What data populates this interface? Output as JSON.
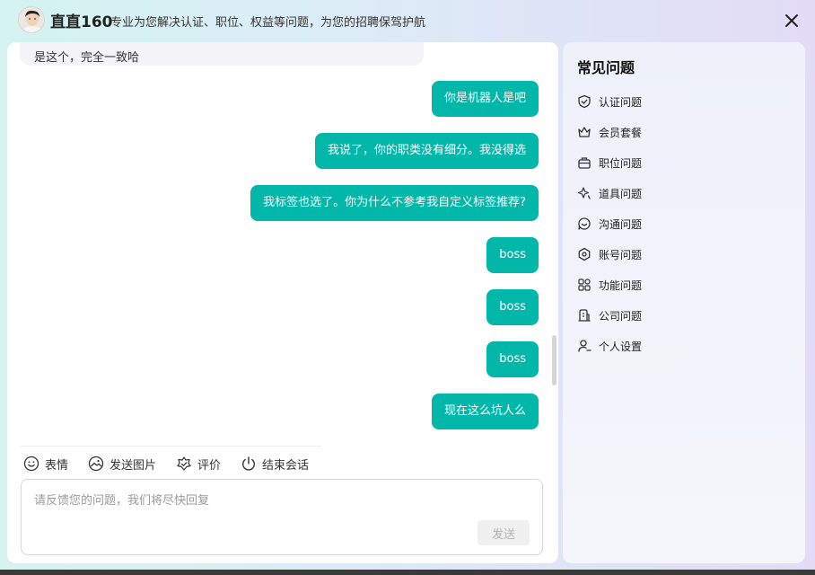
{
  "header": {
    "brand": "直直160",
    "slogan": "专业为您解决认证、职位、权益等问题，为您的招聘保驾护航"
  },
  "chat": {
    "previous_text": "是这个，完全一致哈",
    "messages": [
      "你是机器人是吧",
      "我说了，你的职类没有细分。我没得选",
      "我标签也选了。你为什么不参考我自定义标签推荐?",
      "boss",
      "boss",
      "boss",
      "现在这么坑人么"
    ]
  },
  "toolbar": {
    "emoji": "表情",
    "image": "发送图片",
    "rate": "评价",
    "end": "结束会话"
  },
  "input": {
    "placeholder": "请反馈您的问题，我们将尽快回复",
    "send": "发送"
  },
  "faq": {
    "title": "常见问题",
    "items": [
      {
        "label": "认证问题",
        "icon": "shield-check-icon"
      },
      {
        "label": "会员套餐",
        "icon": "crown-icon"
      },
      {
        "label": "职位问题",
        "icon": "briefcase-icon"
      },
      {
        "label": "道具问题",
        "icon": "sparkle-icon"
      },
      {
        "label": "沟通问题",
        "icon": "chat-bubble-icon"
      },
      {
        "label": "账号问题",
        "icon": "hexagon-account-icon"
      },
      {
        "label": "功能问题",
        "icon": "grid-apps-icon"
      },
      {
        "label": "公司问题",
        "icon": "building-icon"
      },
      {
        "label": "个人设置",
        "icon": "user-settings-icon"
      }
    ]
  },
  "colors": {
    "accent": "#00b7aa"
  }
}
